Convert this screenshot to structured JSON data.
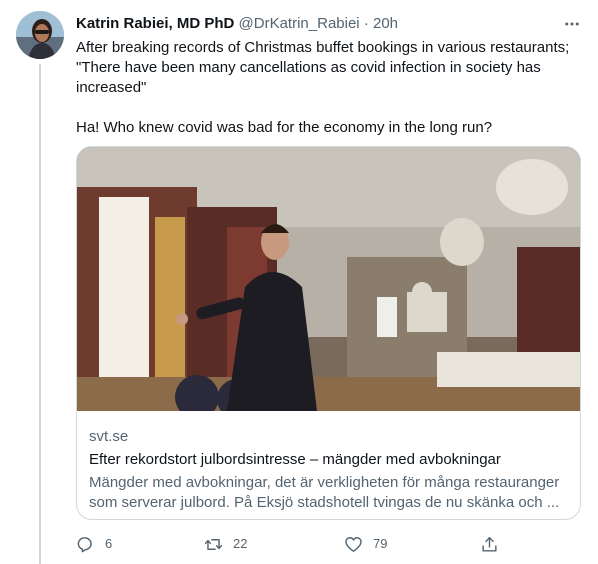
{
  "author": {
    "name": "Katrin Rabiei, MD PhD",
    "handle": "@DrKatrin_Rabiei",
    "separator": "·",
    "time": "20h"
  },
  "tweet": {
    "line1": "After breaking records of Christmas buffet bookings in various restaurants; \"There have been many cancellations as covid infection in society has increased\"",
    "line2": "Ha! Who knew covid was bad for the economy in the long run?"
  },
  "card": {
    "domain": "svt.se",
    "title": "Efter rekordstort julbordsintresse – mängder med avbokningar",
    "description": "Mängder med avbokningar, det är verkligheten för många restauranger som serverar julbord. På Eksjö stadshotell tvingas de nu skänka och ..."
  },
  "actions": {
    "replies": "6",
    "retweets": "22",
    "likes": "79"
  },
  "icons": {
    "more": "more-horizontal-icon",
    "reply": "reply-icon",
    "retweet": "retweet-icon",
    "like": "heart-icon",
    "share": "share-icon"
  },
  "colors": {
    "text_primary": "#0f1419",
    "text_secondary": "#536471",
    "border": "#cfd9de"
  }
}
